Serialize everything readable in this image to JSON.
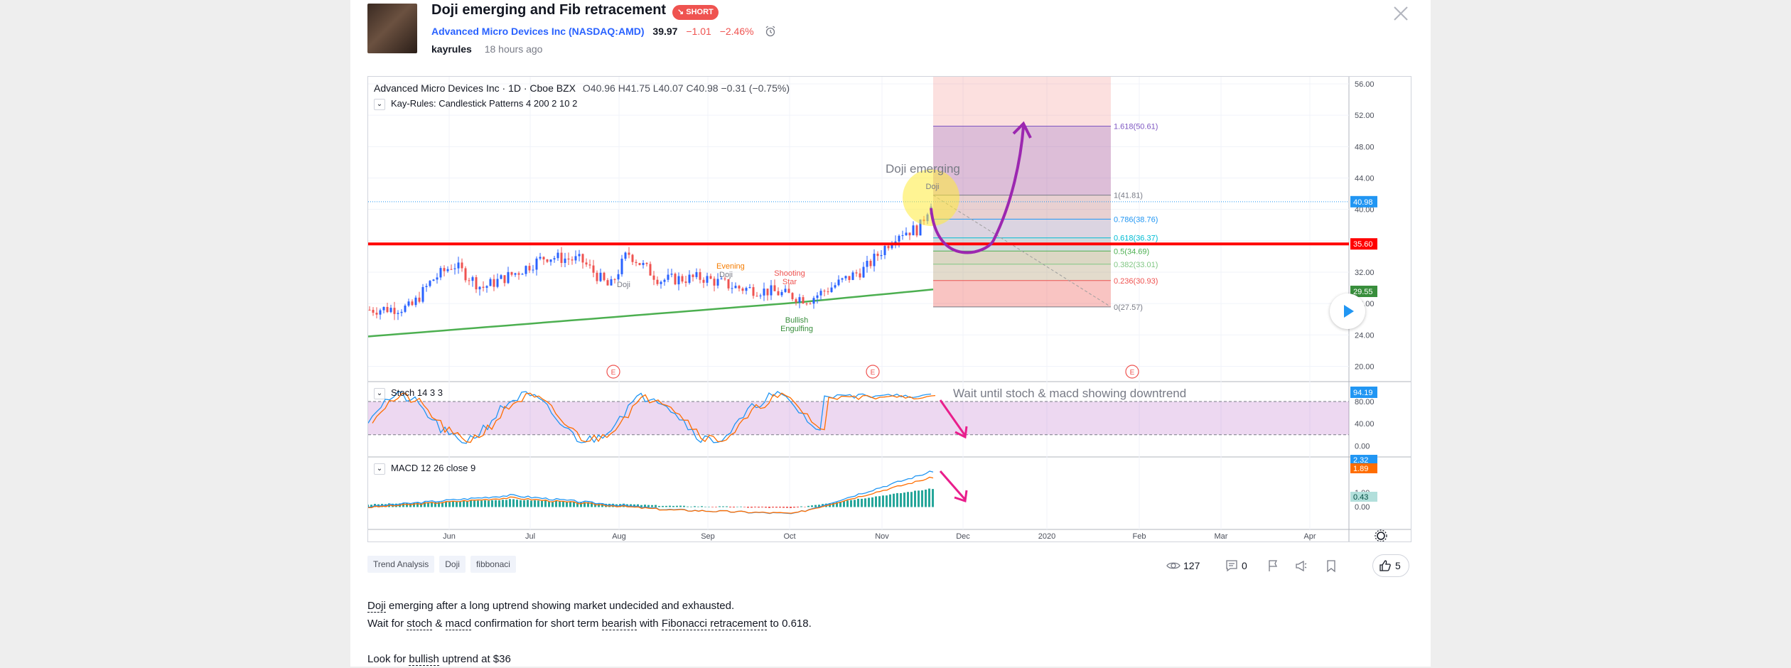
{
  "idea": {
    "title": "Doji emerging and Fib retracement",
    "badge": "SHORT",
    "company": "Advanced Micro Devices Inc",
    "symbol_open": "(",
    "symbol": "NASDAQ:AMD",
    "symbol_close": ")",
    "price": "39.97",
    "change": "−1.01",
    "change_pct": "−2.46%",
    "author": "kayrules",
    "time": "18 hours ago"
  },
  "chart": {
    "legend_title": "Advanced Micro Devices Inc · 1D · Cboe BZX",
    "ohlc": "O40.96  H41.75  L40.07  C40.98  −0.31 (−0.75%)",
    "indicator_candles": "Kay-Rules: Candlestick Patterns 4 200 2 10 2",
    "indicator_stoch": "Stoch 14 3 3",
    "indicator_macd": "MACD 12 26 close 9",
    "annotation_doji": "Doji emerging",
    "annotation_stoch": "Wait until stoch & macd showing downtrend",
    "pattern_labels": [
      "Doji",
      "Evening",
      "Doji",
      "Shooting",
      "Star",
      "Bullish",
      "Engulfing",
      "Doji"
    ],
    "earnings_marker": "E",
    "colors": {
      "up": "#2962ff",
      "down": "#ef5350",
      "sma": "#4caf50",
      "support": "#ff0000",
      "arrow_purple": "#9c27b0",
      "arrow_pink": "#e91e8c"
    }
  },
  "chart_data": {
    "type": "candlestick",
    "price_axis": [
      "56.00",
      "52.00",
      "48.00",
      "44.00",
      "40.00",
      "36.00",
      "32.00",
      "28.00",
      "24.00",
      "20.00"
    ],
    "time_axis": [
      "Jun",
      "Jul",
      "Aug",
      "Sep",
      "Oct",
      "Nov",
      "Dec",
      "2020",
      "Feb",
      "Mar",
      "Apr"
    ],
    "price_badges": {
      "last": "40.98",
      "support": "35.60",
      "sma": "29.55"
    },
    "support_level": 35.6,
    "fib_levels": [
      {
        "label": "1.618(50.61)",
        "value": 50.61
      },
      {
        "label": "1(41.81)",
        "value": 41.81
      },
      {
        "label": "0.786(38.76)",
        "value": 38.76
      },
      {
        "label": "0.618(36.37)",
        "value": 36.37
      },
      {
        "label": "0.5(34.69)",
        "value": 34.69
      },
      {
        "label": "0.382(33.01)",
        "value": 33.01
      },
      {
        "label": "0.236(30.93)",
        "value": 30.93
      },
      {
        "label": "0(27.57)",
        "value": 27.57
      }
    ],
    "stoch_axis": [
      "80.00",
      "40.00",
      "0.00"
    ],
    "stoch_badge": "94.19",
    "macd_axis": [
      "1.00",
      "0.00"
    ],
    "macd_badges": [
      "2.32",
      "1.89",
      "0.43"
    ]
  },
  "tags": [
    "Trend Analysis",
    "Doji",
    "fibbonaci"
  ],
  "stats": {
    "views": "127",
    "comments": "0",
    "likes": "5"
  },
  "description": {
    "l1_a": "Doji",
    "l1_b": " emerging after a long uptrend showing market undecided and exhausted.",
    "l2_a": "Wait for ",
    "l2_b": "stoch",
    "l2_c": " & ",
    "l2_d": "macd",
    "l2_e": " confirmation for short term ",
    "l2_f": "bearish",
    "l2_g": " with ",
    "l2_h": "Fibonacci retracement",
    "l2_i": " to 0.618.",
    "l3_a": "Look for ",
    "l3_b": "bullish",
    "l3_c": " uptrend at $36"
  }
}
